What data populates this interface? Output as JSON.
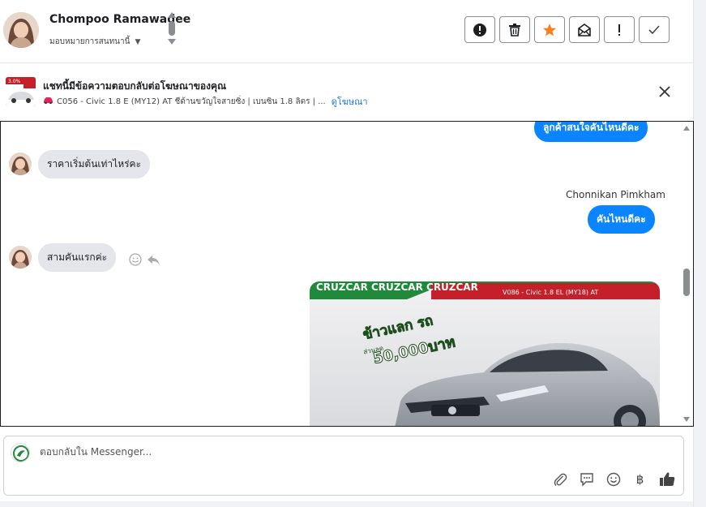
{
  "header": {
    "contact_name": "Chompoo Ramawadee",
    "assign_label": "มอบหมายการสนทนานี้"
  },
  "ad_banner": {
    "title": "แชทนี้มีข้อความตอบกลับต่อโฆษณาของคุณ",
    "subtitle": "C056 - Civic 1.8 E (MY12) AT ชีด้านขวัญใจสายซิ่ง | เบนซิน 1.8 ลิตร | ...",
    "link": "ดูโฆษณา",
    "thumb_badge": "3.0%"
  },
  "messages": {
    "partial_out": "ลูกค้าสนใจคันไหนดีคะ",
    "in_1": "ราคาเริ่มต้นเท่าไหร่คะ",
    "agent_name": "Chonnikan Pimkham",
    "out_1": "คันไหนดีคะ",
    "in_2": "สามคันแรกค่ะ"
  },
  "car_image": {
    "banner_top": "CRUZCAR CRUZCAR CRUZCAR",
    "model_line": "V086 - Civic 1.8 EL (MY18) AT",
    "promo_top": "ข้าวแลก รถ",
    "promo_sub": "ส่วนลด",
    "promo_amount": "50,000บาท"
  },
  "composer": {
    "placeholder": "ตอบกลับใน Messenger..."
  },
  "colors": {
    "messenger_blue": "#0b84ff",
    "star_orange": "#f5821f",
    "incoming_gray": "#e4e6eb"
  }
}
